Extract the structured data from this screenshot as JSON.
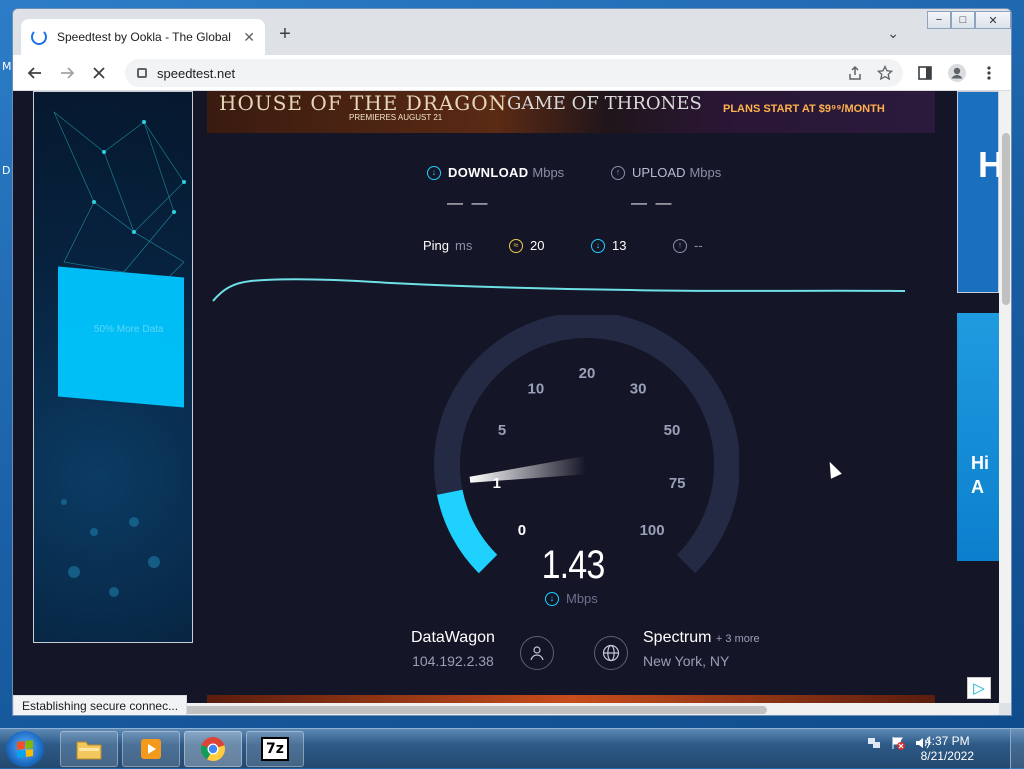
{
  "desktop": {
    "labels": [
      "M",
      "D"
    ]
  },
  "browser": {
    "tab_title": "Speedtest by Ookla - The Global",
    "tab_close": "✕",
    "new_tab": "+",
    "url": "speedtest.net",
    "window_controls": {
      "minimize": "−",
      "maximize": "□",
      "close": "✕"
    }
  },
  "ads": {
    "top_banner": {
      "show1": "HOUSE OF THE DRAGON",
      "premiere": "PREMIERES AUGUST 21",
      "show2": "GAME OF THRONES",
      "offer": "PLANS START AT $9⁹⁹/MONTH"
    },
    "left_ad_text": "50% More Data",
    "right_ad_1": "H",
    "right_ad_2": "Hi A"
  },
  "speedtest": {
    "download_label": "DOWNLOAD",
    "download_unit": "Mbps",
    "download_value": "— —",
    "upload_label": "UPLOAD",
    "upload_unit": "Mbps",
    "upload_value": "— —",
    "ping_label": "Ping",
    "ping_unit": "ms",
    "ping_idle": "20",
    "ping_download": "13",
    "ping_upload": "--",
    "gauge_ticks": [
      "0",
      "1",
      "5",
      "10",
      "20",
      "30",
      "50",
      "75",
      "100"
    ],
    "current_speed": "1.43",
    "current_unit": "Mbps",
    "isp_name": "DataWagon",
    "ip_address": "104.192.2.38",
    "server_name": "Spectrum",
    "server_more": "+ 3 more",
    "server_location": "New York, NY",
    "colors": {
      "accent": "#1fd1ff",
      "graph": "#6fe0e6",
      "background": "#141526",
      "track": "#242a44"
    }
  },
  "status_bar": "Establishing secure connec...",
  "taskbar": {
    "apps": [
      "file-explorer",
      "media-player",
      "chrome",
      "7-zip"
    ],
    "app_7zip_label": "7z",
    "time": "4:37 PM",
    "date": "8/21/2022"
  }
}
